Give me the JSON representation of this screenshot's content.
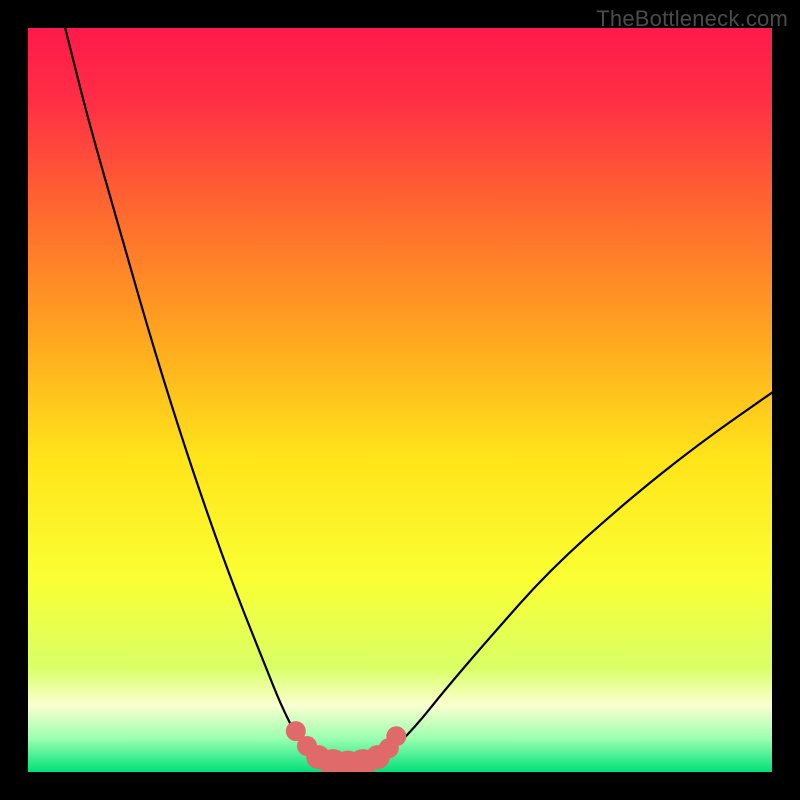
{
  "watermark": {
    "text": "TheBottleneck.com"
  },
  "colors": {
    "frame": "#000000",
    "gradient_stops": [
      {
        "offset": 0.0,
        "color": "#ff1a4b"
      },
      {
        "offset": 0.1,
        "color": "#ff2f45"
      },
      {
        "offset": 0.25,
        "color": "#ff6a2e"
      },
      {
        "offset": 0.42,
        "color": "#ffa81f"
      },
      {
        "offset": 0.58,
        "color": "#ffe51a"
      },
      {
        "offset": 0.74,
        "color": "#faff33"
      },
      {
        "offset": 0.86,
        "color": "#d9ff66"
      },
      {
        "offset": 0.91,
        "color": "#fbffd0"
      },
      {
        "offset": 0.955,
        "color": "#9bffb0"
      },
      {
        "offset": 1.0,
        "color": "#00e07a"
      }
    ],
    "curve_stroke": "#000000",
    "marker_fill": "#e06a6a",
    "marker_stroke": "#c94f4f"
  },
  "chart_data": {
    "type": "line",
    "title": "",
    "xlabel": "",
    "ylabel": "",
    "xlim": [
      0,
      100
    ],
    "ylim": [
      0,
      100
    ],
    "grid": false,
    "legend": null,
    "series": [
      {
        "name": "left-branch",
        "x": [
          5,
          8,
          12,
          16,
          20,
          24,
          28,
          32,
          34,
          36,
          38
        ],
        "y": [
          100,
          88,
          74,
          60,
          47,
          35,
          24,
          14,
          9,
          5,
          2
        ]
      },
      {
        "name": "valley-floor",
        "x": [
          38,
          40,
          42,
          44,
          46,
          48
        ],
        "y": [
          2,
          1,
          1,
          1,
          1,
          2
        ]
      },
      {
        "name": "right-branch",
        "x": [
          48,
          52,
          56,
          62,
          70,
          80,
          90,
          100
        ],
        "y": [
          2,
          6,
          11,
          18,
          27,
          36,
          44,
          51
        ]
      }
    ],
    "markers": {
      "name": "valley-markers",
      "x": [
        36,
        37.5,
        39,
        41,
        43,
        45,
        47,
        48.5,
        49.5
      ],
      "y": [
        5.5,
        3.5,
        2,
        1.2,
        1,
        1.2,
        2,
        3.2,
        4.8
      ],
      "size": [
        10,
        10,
        12,
        14,
        14,
        14,
        12,
        10,
        10
      ]
    }
  }
}
